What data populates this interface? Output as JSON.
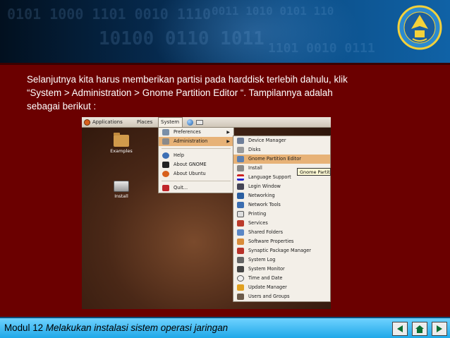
{
  "body": {
    "line1": "Selanjutnya kita harus memberikan partisi pada harddisk terlebih dahulu, klik",
    "line2": "“System > Administration > Gnome Partition Editor “. Tampilannya adalah",
    "line3": "sebagai berikut :"
  },
  "screenshot": {
    "panel": {
      "applications": "Applications",
      "places": "Places",
      "system": "System"
    },
    "desktop_icons": [
      {
        "label": "Examples",
        "icon": "folder-icon"
      },
      {
        "label": "Install",
        "icon": "disk-icon"
      }
    ],
    "system_menu": {
      "items": [
        {
          "label": "Preferences",
          "icon": "preferences-icon",
          "submenu": true
        },
        {
          "label": "Administration",
          "icon": "administration-icon",
          "submenu": true,
          "highlighted": true
        },
        {
          "label": "Help",
          "icon": "help-icon"
        },
        {
          "label": "About GNOME",
          "icon": "gnome-icon"
        },
        {
          "label": "About Ubuntu",
          "icon": "ubuntu-icon"
        },
        {
          "label": "Quit...",
          "icon": "quit-icon"
        }
      ]
    },
    "admin_menu": {
      "items": [
        {
          "label": "Device Manager",
          "icon": "device-manager-icon"
        },
        {
          "label": "Disks",
          "icon": "disks-icon"
        },
        {
          "label": "Gnome Partition Editor",
          "icon": "partition-editor-icon",
          "highlighted": true
        },
        {
          "label": "Install",
          "icon": "install-icon"
        },
        {
          "label": "Language Support",
          "icon": "language-icon"
        },
        {
          "label": "Login Window",
          "icon": "login-window-icon"
        },
        {
          "label": "Networking",
          "icon": "networking-icon"
        },
        {
          "label": "Network Tools",
          "icon": "network-tools-icon"
        },
        {
          "label": "Printing",
          "icon": "printer-icon"
        },
        {
          "label": "Services",
          "icon": "services-icon"
        },
        {
          "label": "Shared Folders",
          "icon": "shared-folders-icon"
        },
        {
          "label": "Software Properties",
          "icon": "software-properties-icon"
        },
        {
          "label": "Synaptic Package Manager",
          "icon": "synaptic-icon"
        },
        {
          "label": "System Log",
          "icon": "system-log-icon"
        },
        {
          "label": "System Monitor",
          "icon": "system-monitor-icon"
        },
        {
          "label": "Time and Date",
          "icon": "clock-icon"
        },
        {
          "label": "Update Manager",
          "icon": "update-manager-icon"
        },
        {
          "label": "Users and Groups",
          "icon": "users-icon"
        }
      ]
    },
    "tooltip": "Gnome Partiti"
  },
  "footer": {
    "prefix": "Modul 12",
    "title": "Melakukan instalasi sistem operasi jaringan"
  },
  "colors": {
    "slide_bg": "#6b0000",
    "footer_bg": "#1fa8e8",
    "menu_highlight": "#e7b277"
  }
}
